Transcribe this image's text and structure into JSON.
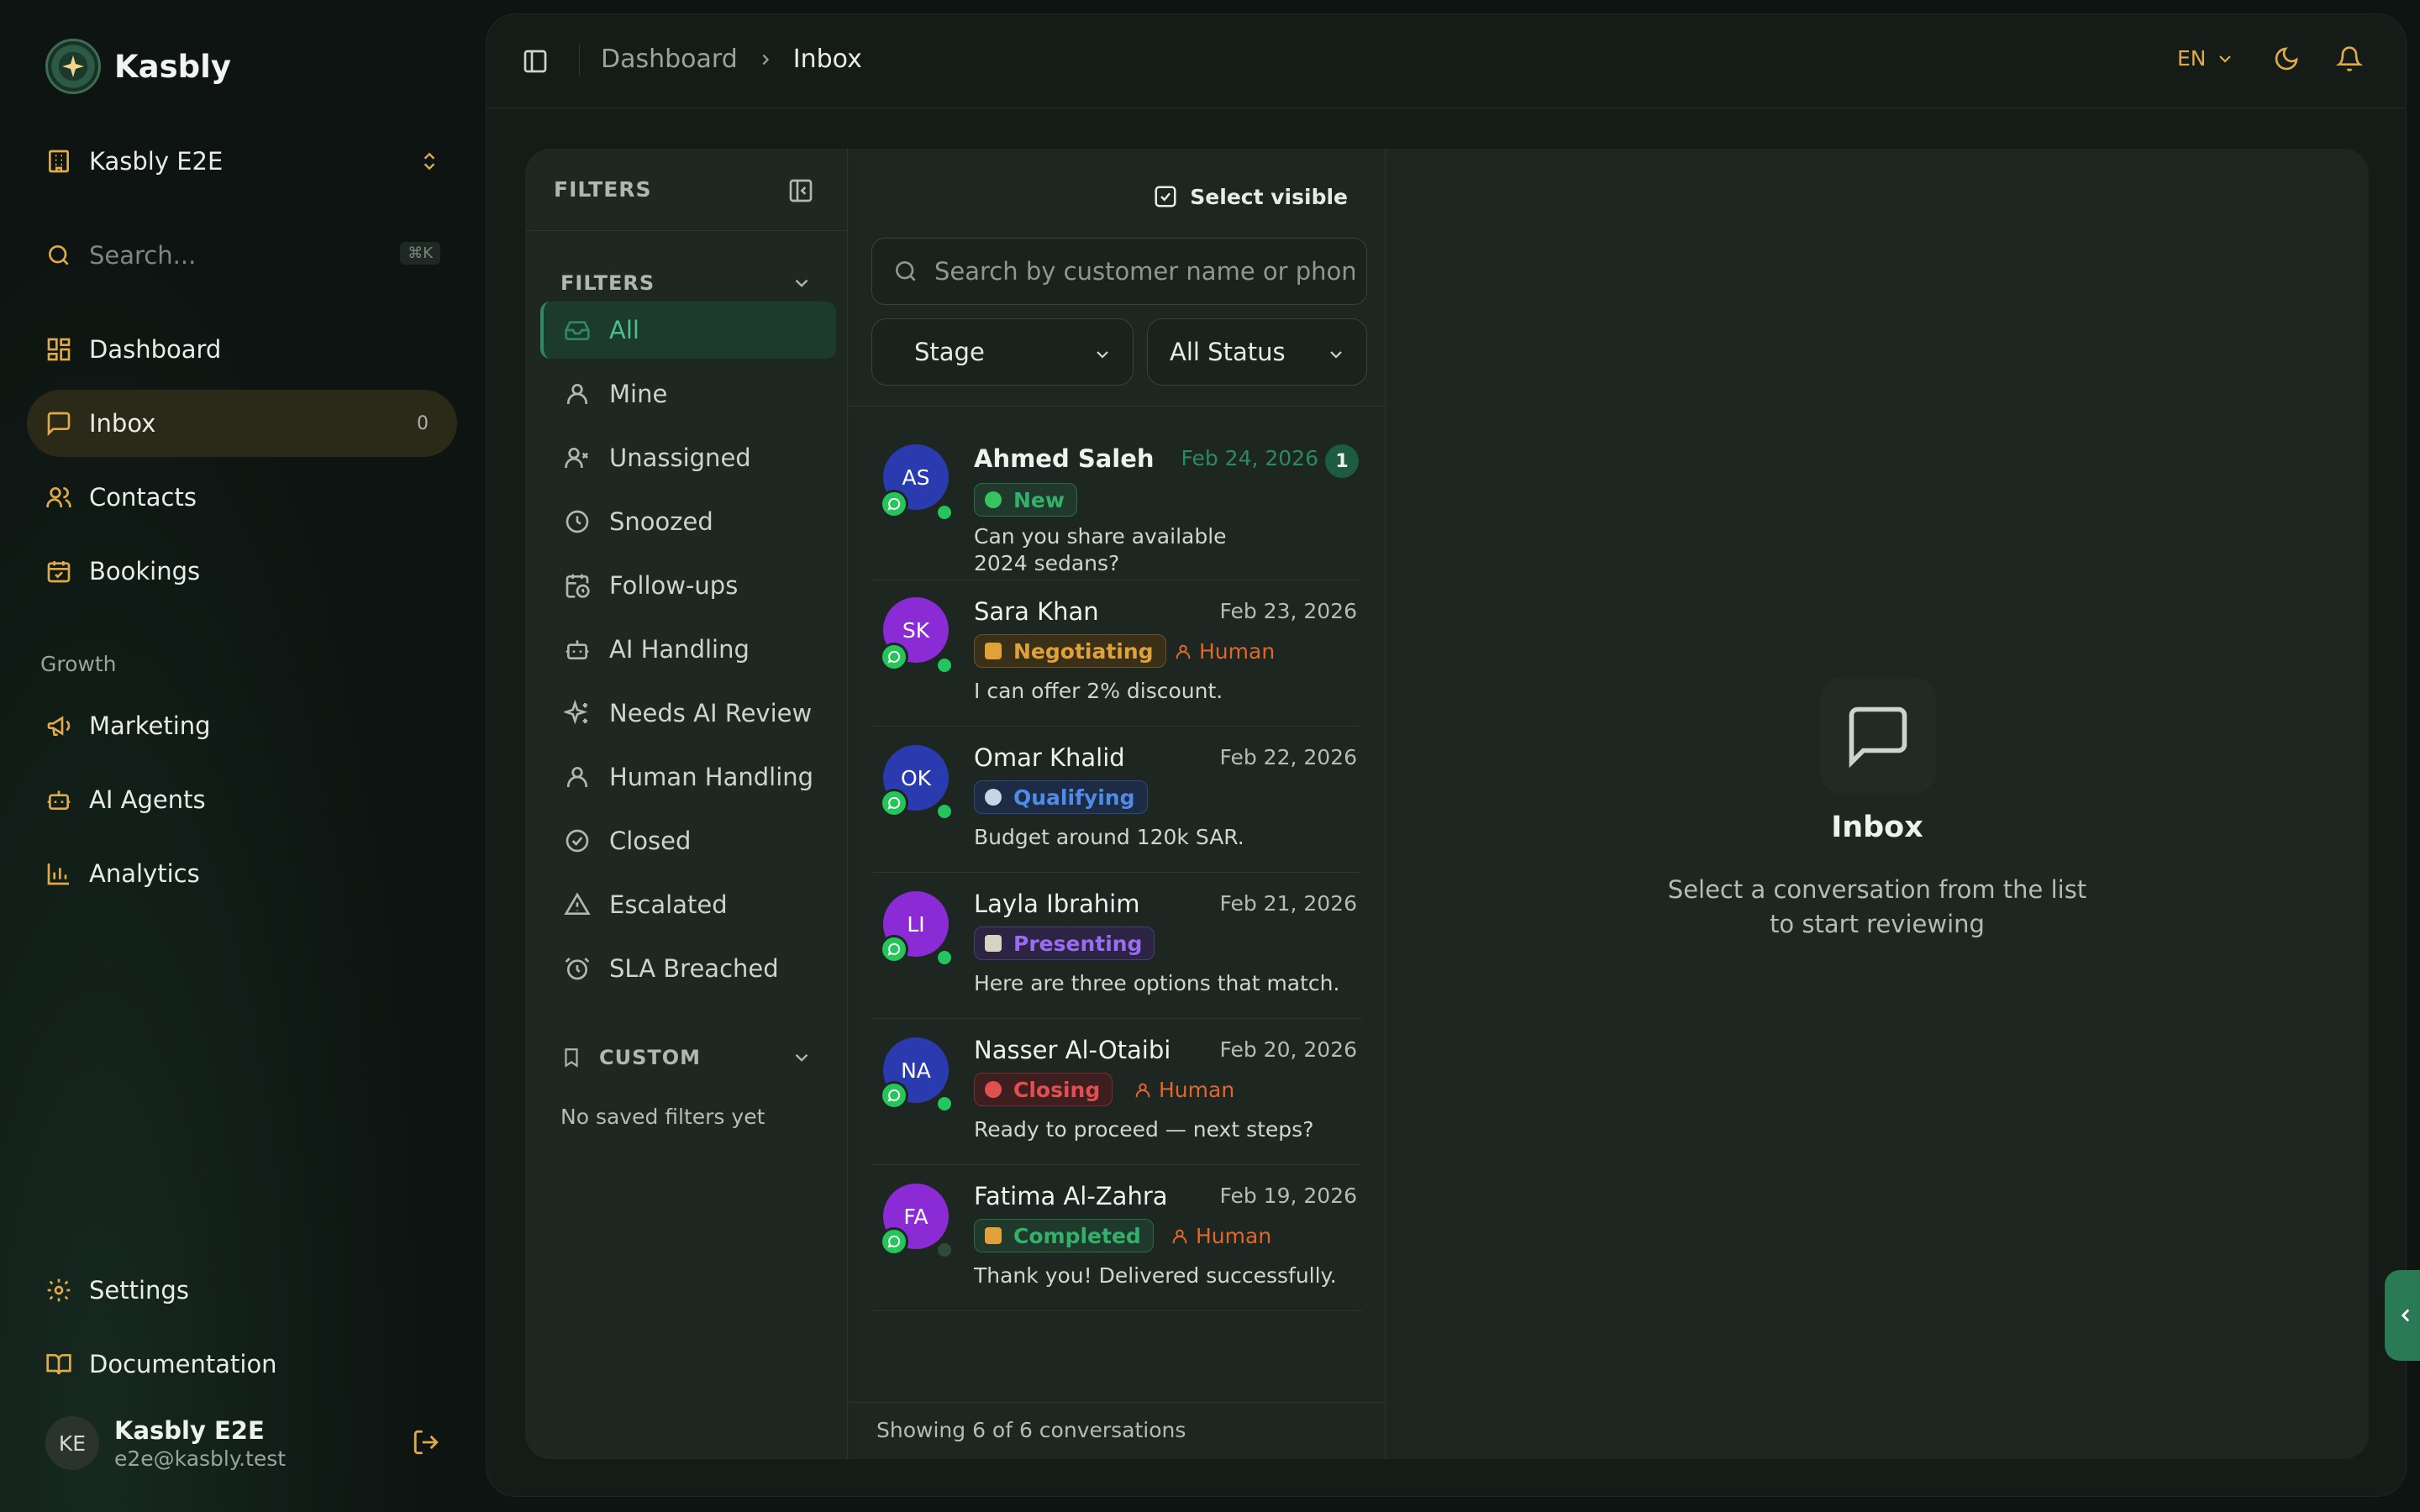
{
  "brand": {
    "name": "Kasbly"
  },
  "workspace": {
    "name": "Kasbly E2E"
  },
  "search": {
    "placeholder": "Search...",
    "shortcut": "⌘K"
  },
  "nav": {
    "dashboard": "Dashboard",
    "inbox": "Inbox",
    "inbox_count": "0",
    "contacts": "Contacts",
    "bookings": "Bookings",
    "growth_label": "Growth",
    "marketing": "Marketing",
    "ai_agents": "AI Agents",
    "analytics": "Analytics",
    "settings": "Settings",
    "documentation": "Documentation"
  },
  "user": {
    "name": "Kasbly E2E",
    "email": "e2e@kasbly.test",
    "initials": "KE"
  },
  "topbar": {
    "crumb_1": "Dashboard",
    "crumb_2": "Inbox",
    "language": "EN"
  },
  "filters": {
    "panel_title": "FILTERS",
    "group_title": "FILTERS",
    "items": [
      "All",
      "Mine",
      "Unassigned",
      "Snoozed",
      "Follow-ups",
      "AI Handling",
      "Needs AI Review",
      "Human Handling",
      "Closed",
      "Escalated",
      "SLA Breached"
    ],
    "active_index": 0,
    "custom_title": "CUSTOM",
    "no_saved": "No saved filters yet"
  },
  "list": {
    "select_visible": "Select visible",
    "search_placeholder": "Search by customer name or phone",
    "stage_select": "Stage",
    "status_select": "All Status",
    "footer": "Showing 6 of 6 conversations"
  },
  "conversations": [
    {
      "initials": "AS",
      "name": "Ahmed Saleh",
      "date": "Feb 24, 2026",
      "unread": "1",
      "stage": "New",
      "preview": "Can you share available 2024 sedans?",
      "online": true,
      "avatar_color": "#2a3bb0",
      "stage_color": "#35b06a"
    },
    {
      "initials": "SK",
      "name": "Sara Khan",
      "date": "Feb 23, 2026",
      "stage": "Negotiating",
      "human": "Human",
      "preview": "I can offer 2% discount.",
      "online": true,
      "avatar_color": "#8a2bd6",
      "stage_color": "#e0a13a"
    },
    {
      "initials": "OK",
      "name": "Omar Khalid",
      "date": "Feb 22, 2026",
      "stage": "Qualifying",
      "preview": "Budget around 120k SAR.",
      "online": true,
      "avatar_color": "#2a3bb0",
      "stage_color": "#4f8be8"
    },
    {
      "initials": "LI",
      "name": "Layla Ibrahim",
      "date": "Feb 21, 2026",
      "stage": "Presenting",
      "preview": "Here are three options that match.",
      "online": true,
      "avatar_color": "#8a2bd6",
      "stage_color": "#9a6cf0"
    },
    {
      "initials": "NA",
      "name": "Nasser Al-Otaibi",
      "date": "Feb 20, 2026",
      "stage": "Closing",
      "human": "Human",
      "preview": "Ready to proceed — next steps?",
      "online": true,
      "avatar_color": "#2a3bb0",
      "stage_color": "#e05050"
    },
    {
      "initials": "FA",
      "name": "Fatima Al-Zahra",
      "date": "Feb 19, 2026",
      "stage": "Completed",
      "human": "Human",
      "preview": "Thank you! Delivered successfully.",
      "online": false,
      "avatar_color": "#8a2bd6",
      "stage_color": "#35b06a"
    }
  ],
  "empty_state": {
    "title": "Inbox",
    "subtitle": "Select a conversation from the list to start reviewing"
  },
  "colors": {
    "accent": "#e0a94a",
    "brand_green": "#2a7b55"
  }
}
